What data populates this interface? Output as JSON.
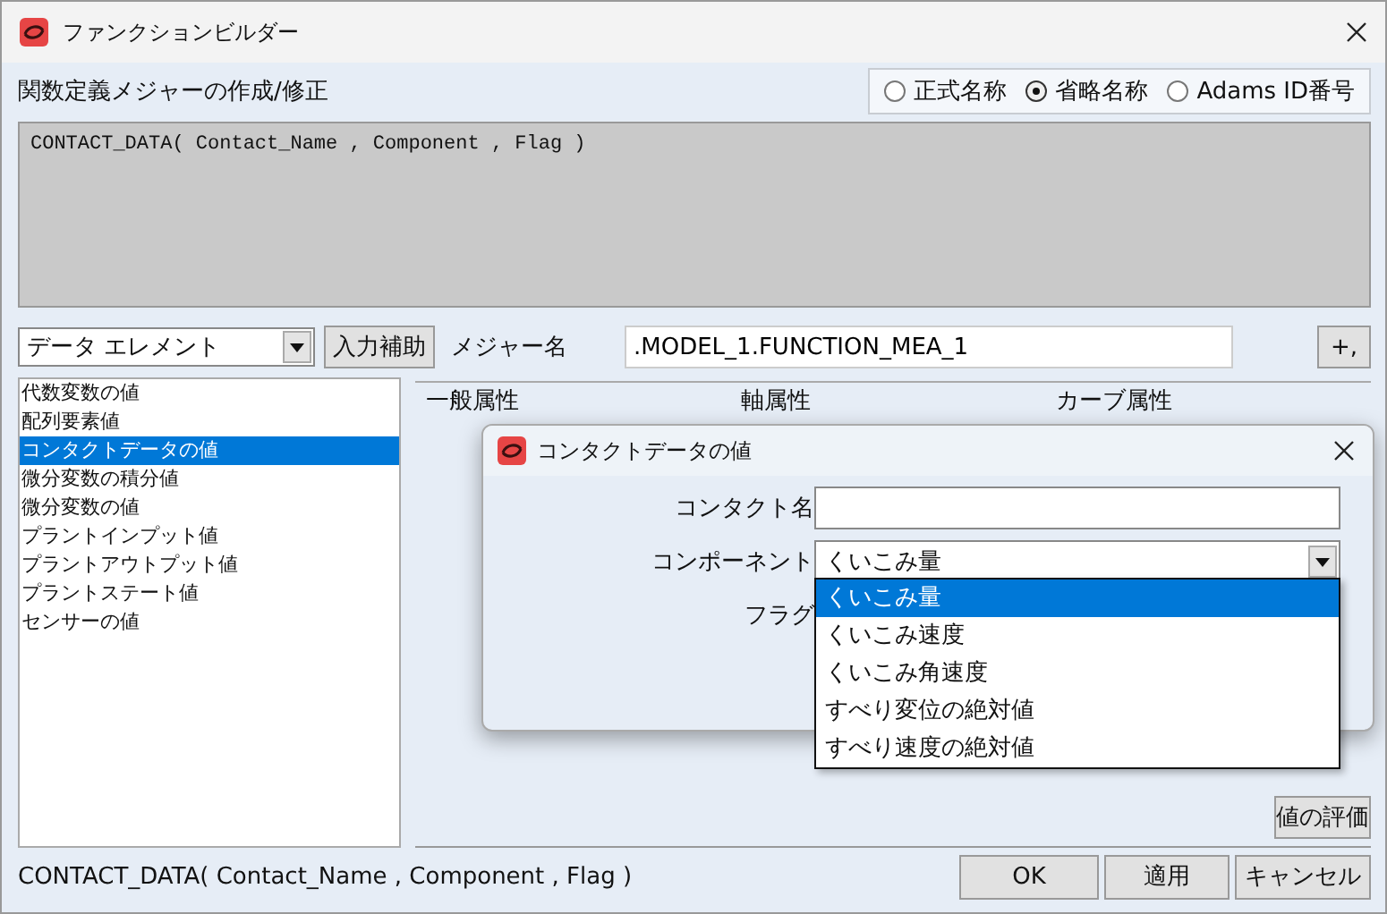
{
  "window": {
    "title": "ファンクションビルダー"
  },
  "heading": "関数定義メジャーの作成/修正",
  "name_modes": [
    {
      "label": "正式名称",
      "selected": false
    },
    {
      "label": "省略名称",
      "selected": true
    },
    {
      "label": "Adams ID番号",
      "selected": false
    }
  ],
  "expression": "CONTACT_DATA( Contact_Name , Component , Flag )",
  "category": {
    "value": "データ エレメント"
  },
  "assist_button": "入力補助",
  "measure_name": {
    "label": "メジャー名",
    "value": ".MODEL_1.FUNCTION_MEA_1"
  },
  "plus_button": "+,",
  "functions": [
    {
      "label": "代数変数の値",
      "selected": false
    },
    {
      "label": "配列要素値",
      "selected": false
    },
    {
      "label": "コンタクトデータの値",
      "selected": true
    },
    {
      "label": "微分変数の積分値",
      "selected": false
    },
    {
      "label": "微分変数の値",
      "selected": false
    },
    {
      "label": "プラントインプット値",
      "selected": false
    },
    {
      "label": "プラントアウトプット値",
      "selected": false
    },
    {
      "label": "プラントステート値",
      "selected": false
    },
    {
      "label": "センサーの値",
      "selected": false
    }
  ],
  "property_tabs": [
    "一般属性",
    "軸属性",
    "カーブ属性"
  ],
  "evaluate_button": "値の評価",
  "status": "CONTACT_DATA( Contact_Name , Component , Flag )",
  "buttons": [
    "OK",
    "適用",
    "キャンセル"
  ],
  "dialog": {
    "title": "コンタクトデータの値",
    "fields": [
      {
        "kind": "text",
        "label": "コンタクト名"
      },
      {
        "kind": "select",
        "label": "コンポーネント",
        "value": "くいこみ量",
        "options": [
          {
            "label": "くいこみ量",
            "selected": true
          },
          {
            "label": "くいこみ速度",
            "selected": false
          },
          {
            "label": "くいこみ角速度",
            "selected": false
          },
          {
            "label": "すべり変位の絶対値",
            "selected": false
          },
          {
            "label": "すべり速度の絶対値",
            "selected": false
          }
        ]
      },
      {
        "kind": "label",
        "label": "フラグ"
      }
    ]
  }
}
